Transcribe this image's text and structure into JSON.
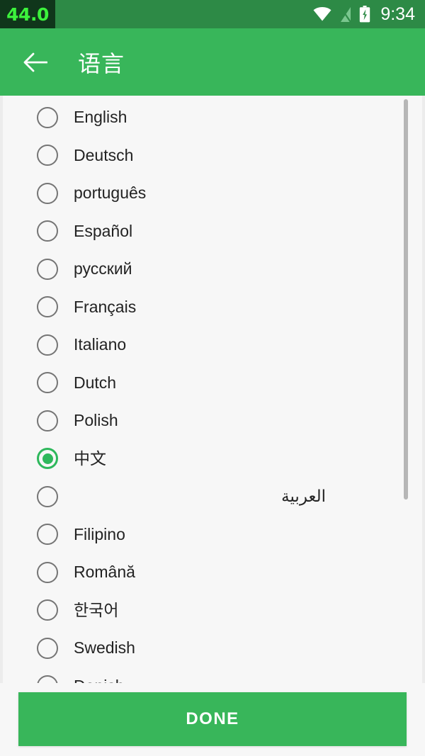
{
  "statusbar": {
    "fps_badge": "44.0",
    "time": "9:34",
    "icons": [
      "wifi-icon",
      "sim-card-no-signal-icon",
      "battery-charging-icon"
    ],
    "background_color": "#2d8a46",
    "badge_background_color": "#10361b",
    "badge_text_color": "#3cf23c"
  },
  "appbar": {
    "back_label": "back-arrow",
    "title": "语言",
    "background_color": "#38b65a",
    "text_color": "#ffffff"
  },
  "list": {
    "selected_index": 9,
    "accent_color": "#2eb85c",
    "items": [
      {
        "label": "English",
        "selected": false,
        "rtl": false
      },
      {
        "label": "Deutsch",
        "selected": false,
        "rtl": false
      },
      {
        "label": "português",
        "selected": false,
        "rtl": false
      },
      {
        "label": "Español",
        "selected": false,
        "rtl": false
      },
      {
        "label": "русский",
        "selected": false,
        "rtl": false
      },
      {
        "label": "Français",
        "selected": false,
        "rtl": false
      },
      {
        "label": "Italiano",
        "selected": false,
        "rtl": false
      },
      {
        "label": "Dutch",
        "selected": false,
        "rtl": false
      },
      {
        "label": "Polish",
        "selected": false,
        "rtl": false
      },
      {
        "label": "中文",
        "selected": true,
        "rtl": false
      },
      {
        "label": "العربية",
        "selected": false,
        "rtl": true
      },
      {
        "label": "Filipino",
        "selected": false,
        "rtl": false
      },
      {
        "label": "Română",
        "selected": false,
        "rtl": false
      },
      {
        "label": "한국어",
        "selected": false,
        "rtl": false
      },
      {
        "label": "Swedish",
        "selected": false,
        "rtl": false
      },
      {
        "label": "Danish",
        "selected": false,
        "rtl": false
      }
    ]
  },
  "footer": {
    "done_label": "DONE",
    "background_color": "#38b65a",
    "text_color": "#ffffff"
  }
}
